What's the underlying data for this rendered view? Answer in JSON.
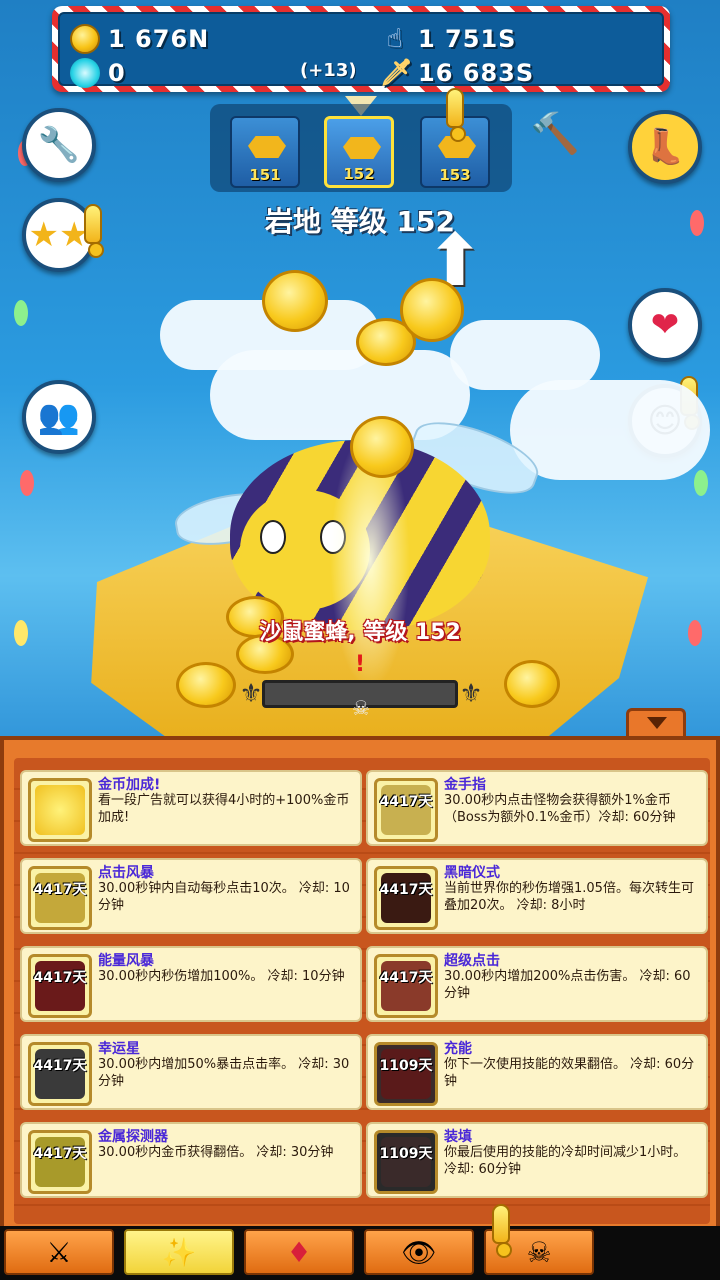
{
  "stats": {
    "gold": "1 676N",
    "souls": "0",
    "souls_gain": "(+13)",
    "click_damage": "1 751S",
    "dps": "16 683S"
  },
  "zones": [
    {
      "label": "151"
    },
    {
      "label": "152"
    },
    {
      "label": "153"
    }
  ],
  "zone_title": "岩地 等级 152",
  "monster_name": "沙鼠蜜蜂, 等级 152",
  "side_buttons": {
    "left": [
      "wrench-icon",
      "stars-icon",
      "clan-icon"
    ],
    "right": [
      "boot-icon",
      "rubies-icon",
      "mercenary-icon"
    ]
  },
  "skills": [
    {
      "name": "金币加成!",
      "cooldown": "",
      "desc": "看一段广告就可以获得4小时的+100%金币加成!",
      "icon": "pig-icon"
    },
    {
      "name": "金手指",
      "cooldown": "4417天",
      "desc": "30.00秒内点击怪物会获得额外1%金币（Boss为额外0.1%金币）冷却: 60分钟",
      "icon": "golden-hand-icon"
    },
    {
      "name": "点击风暴",
      "cooldown": "4417天",
      "desc": "30.00秒钟内自动每秒点击10次。 冷却: 10分钟",
      "icon": "clickstorm-icon"
    },
    {
      "name": "黑暗仪式",
      "cooldown": "4417天",
      "desc": "当前世界你的秒伤增强1.05倍。每次转生可叠加20次。 冷却: 8小时",
      "icon": "dark-ritual-icon"
    },
    {
      "name": "能量风暴",
      "cooldown": "4417天",
      "desc": "30.00秒内秒伤增加100%。 冷却: 10分钟",
      "icon": "powersurge-icon"
    },
    {
      "name": "超级点击",
      "cooldown": "4417天",
      "desc": "30.00秒内增加200%点击伤害。 冷却: 60分钟",
      "icon": "super-clicks-icon"
    },
    {
      "name": "幸运星",
      "cooldown": "4417天",
      "desc": "30.00秒内增加50%暴击点击率。 冷却: 30分钟",
      "icon": "lucky-strikes-icon"
    },
    {
      "name": "充能",
      "cooldown": "1109天",
      "desc": "你下一次使用技能的效果翻倍。 冷却: 60分钟",
      "icon": "energize-icon"
    },
    {
      "name": "金属探测器",
      "cooldown": "4417天",
      "desc": "30.00秒内金币获得翻倍。 冷却: 30分钟",
      "icon": "metal-detector-icon"
    },
    {
      "name": "装填",
      "cooldown": "1109天",
      "desc": "你最后使用的技能的冷却时间减少1小时。 冷却: 60分钟",
      "icon": "reload-icon"
    }
  ],
  "nav": [
    {
      "icon": "crossed-swords-icon",
      "glyph": "⚔"
    },
    {
      "icon": "magic-wand-icon",
      "glyph": "✨"
    },
    {
      "icon": "ruby-icon",
      "glyph": "💎"
    },
    {
      "icon": "ancients-eye-icon",
      "glyph": "👁"
    },
    {
      "icon": "skull-icon",
      "glyph": "💀"
    }
  ],
  "colors": {
    "skill_name": "#4a28d8",
    "panel": "#e77a2c",
    "nav_active": "#f2d43a"
  }
}
